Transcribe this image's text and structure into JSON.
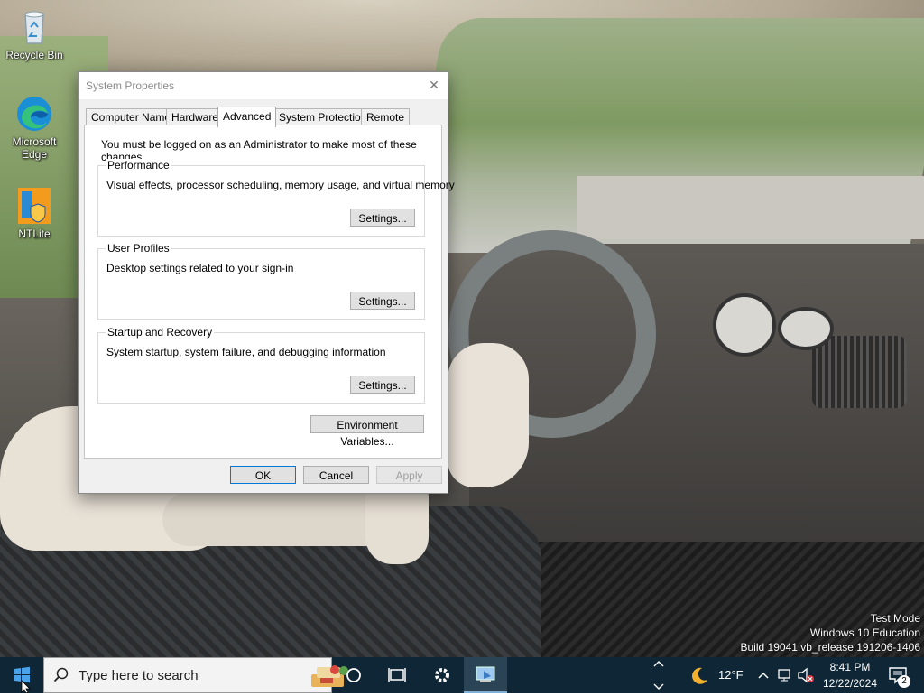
{
  "desktop": {
    "icons": [
      {
        "label": "Recycle Bin"
      },
      {
        "label": "Microsoft Edge"
      },
      {
        "label": "NTLite"
      }
    ]
  },
  "dialog": {
    "title": "System Properties",
    "close_glyph": "✕",
    "tabs": [
      {
        "label": "Computer Name"
      },
      {
        "label": "Hardware"
      },
      {
        "label": "Advanced",
        "active": true
      },
      {
        "label": "System Protection"
      },
      {
        "label": "Remote"
      }
    ],
    "admin_note": "You must be logged on as an Administrator to make most of these changes.",
    "groups": {
      "performance": {
        "title": "Performance",
        "desc": "Visual effects, processor scheduling, memory usage, and virtual memory",
        "button": "Settings..."
      },
      "user_profiles": {
        "title": "User Profiles",
        "desc": "Desktop settings related to your sign-in",
        "button": "Settings..."
      },
      "startup_recovery": {
        "title": "Startup and Recovery",
        "desc": "System startup, system failure, and debugging information",
        "button": "Settings..."
      }
    },
    "env_button": "Environment Variables...",
    "ok": "OK",
    "cancel": "Cancel",
    "apply": "Apply"
  },
  "watermark": {
    "line1": "Test Mode",
    "line2": "Windows 10 Education",
    "line3": "Build 19041.vb_release.191206-1406"
  },
  "taskbar": {
    "search_placeholder": "Type here to search",
    "weather": "12°F",
    "time": "8:41 PM",
    "date": "12/22/2024",
    "notifications": "2",
    "accent": "#0078d7"
  }
}
